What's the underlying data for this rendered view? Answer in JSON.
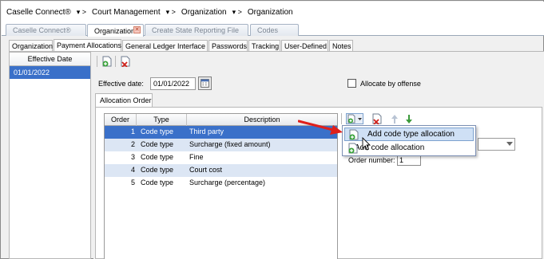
{
  "breadcrumb": {
    "items": [
      "Caselle Connect®",
      "Court Management",
      "Organization",
      "Organization"
    ],
    "separator": "▾ >"
  },
  "top_tabs": [
    {
      "label": "Caselle Connect®",
      "active": false
    },
    {
      "label": "Organization",
      "active": true,
      "closable": true
    },
    {
      "label": "Create State Reporting File",
      "active": false
    },
    {
      "label": "Codes",
      "active": false
    }
  ],
  "sub_tabs": [
    {
      "label": "Organization"
    },
    {
      "label": "Payment Allocations"
    },
    {
      "label": "General Ledger Interface"
    },
    {
      "label": "Passwords"
    },
    {
      "label": "Tracking"
    },
    {
      "label": "User-Defined"
    },
    {
      "label": "Notes"
    }
  ],
  "left_panel": {
    "header": "Effective Date",
    "rows": [
      "01/01/2022"
    ]
  },
  "form": {
    "effective_date_label": "Effective date:",
    "effective_date_value": "01/01/2022",
    "allocate_by_offense_label": "Allocate by offense",
    "allocate_by_offense_checked": false
  },
  "allocation_tab": {
    "label": "Allocation Order"
  },
  "grid": {
    "columns": [
      "Order",
      "Type",
      "Description"
    ],
    "rows": [
      {
        "order": "1",
        "type": "Code type",
        "description": "Third party",
        "selected": true
      },
      {
        "order": "2",
        "type": "Code type",
        "description": "Surcharge (fixed amount)"
      },
      {
        "order": "3",
        "type": "Code type",
        "description": "Fine"
      },
      {
        "order": "4",
        "type": "Code type",
        "description": "Court cost"
      },
      {
        "order": "5",
        "type": "Code type",
        "description": "Surcharge (percentage)"
      }
    ]
  },
  "add_menu": {
    "items": [
      {
        "label": "Add code type allocation",
        "highlighted": true
      },
      {
        "label": "Add code allocation"
      }
    ]
  },
  "detail": {
    "order_number_label": "Order number:",
    "order_number_value": "1"
  },
  "colors": {
    "selection": "#3a70c9",
    "alt_row": "#dce6f4",
    "arrow": "#e0201b",
    "menu_hover": "#cfe0f5"
  }
}
